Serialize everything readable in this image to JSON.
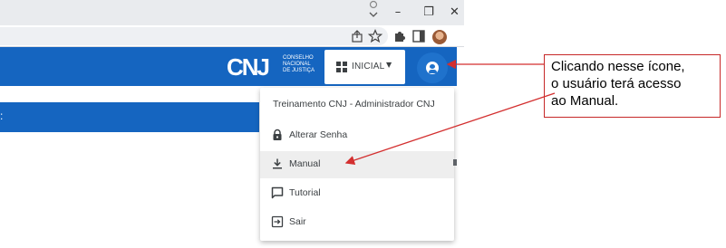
{
  "browser": {
    "window_controls": {
      "minimize": "–",
      "maximize": "❐",
      "close": "✕"
    },
    "toolbar_icons": [
      "share-icon",
      "star-icon",
      "puzzle-icon",
      "side-panel-icon",
      "profile-avatar"
    ]
  },
  "header": {
    "logo": {
      "mark": "CNJ",
      "lines": [
        "CONSELHO",
        "NACIONAL",
        "DE JUSTIÇA"
      ]
    },
    "home_button_label": "INICIAL",
    "home_button_icon": "dashboard-grid-icon",
    "account_icon": "account-circle-icon",
    "background": "#1565c0"
  },
  "sub_bar": {
    "glyph": ":"
  },
  "menu": {
    "header": "Treinamento CNJ - Administrador CNJ",
    "items": [
      {
        "label": "Alterar Senha",
        "icon": "lock-icon"
      },
      {
        "label": "Manual",
        "icon": "download-icon",
        "highlighted": true
      },
      {
        "label": "Tutorial",
        "icon": "message-square-icon"
      },
      {
        "label": "Sair",
        "icon": "logout-icon"
      }
    ]
  },
  "callout": {
    "lines": [
      "Clicando nesse ícone,",
      "o usuário terá acesso",
      "ao Manual."
    ],
    "border_color": "#c62828",
    "arrow_color": "#d32f2f"
  }
}
